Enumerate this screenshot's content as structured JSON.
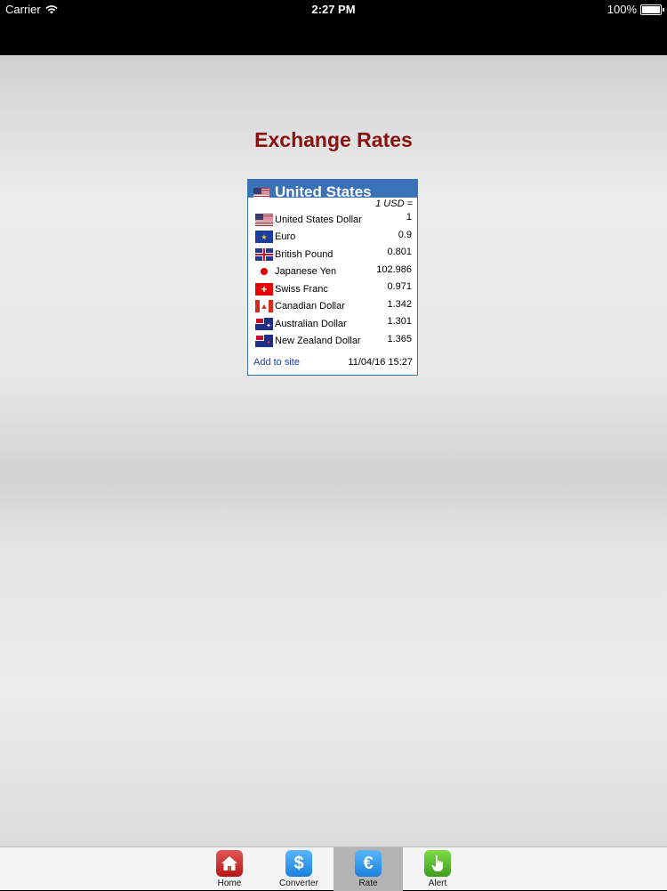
{
  "status_bar": {
    "carrier": "Carrier",
    "time": "2:27 PM",
    "battery": "100%"
  },
  "page": {
    "title": "Exchange Rates"
  },
  "widget": {
    "header": "United States",
    "base_label": "1 USD =",
    "rows": [
      {
        "flag": "us-flag-icon",
        "name": "United States Dollar",
        "value": "1"
      },
      {
        "flag": "eu-flag-icon",
        "name": "Euro",
        "value": "0.9"
      },
      {
        "flag": "gb-flag-icon",
        "name": "British Pound",
        "value": "0.801"
      },
      {
        "flag": "jp-flag-icon",
        "name": "Japanese Yen",
        "value": "102.986"
      },
      {
        "flag": "ch-flag-icon",
        "name": "Swiss Franc",
        "value": "0.971"
      },
      {
        "flag": "ca-flag-icon",
        "name": "Canadian Dollar",
        "value": "1.342"
      },
      {
        "flag": "au-flag-icon",
        "name": "Australian Dollar",
        "value": "1.301"
      },
      {
        "flag": "nz-flag-icon",
        "name": "New Zealand Dollar",
        "value": "1.365"
      }
    ],
    "footer_link": "Add to site",
    "timestamp": "11/04/16 15:27"
  },
  "tab_bar": {
    "tabs": [
      {
        "label": "Home",
        "icon": "home-icon"
      },
      {
        "label": "Converter",
        "icon": "dollar-icon"
      },
      {
        "label": "Rate",
        "icon": "euro-icon",
        "active": true
      },
      {
        "label": "Alert",
        "icon": "hand-pointer-icon"
      }
    ]
  },
  "colors": {
    "title": "#8b0f0f",
    "widget_header": "#3a72b8",
    "link": "#1a3fc7"
  }
}
